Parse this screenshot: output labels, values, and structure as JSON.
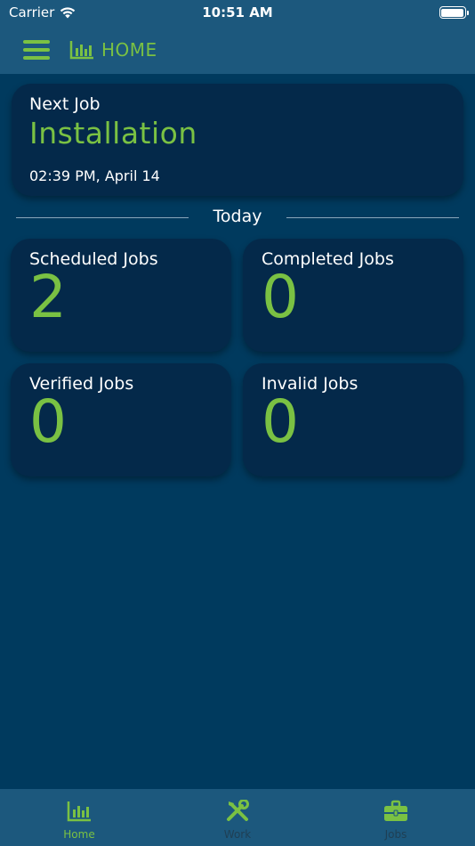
{
  "status_bar": {
    "carrier": "Carrier",
    "time": "10:51 AM"
  },
  "nav": {
    "title": "HOME"
  },
  "next_job": {
    "label": "Next Job",
    "type": "Installation",
    "datetime": "02:39 PM, April 14"
  },
  "section": {
    "today": "Today"
  },
  "stats": [
    {
      "label": "Scheduled Jobs",
      "value": "2"
    },
    {
      "label": "Completed Jobs",
      "value": "0"
    },
    {
      "label": "Verified Jobs",
      "value": "0"
    },
    {
      "label": "Invalid Jobs",
      "value": "0"
    }
  ],
  "tabs": [
    {
      "label": "Home",
      "icon": "bar-chart-icon",
      "active": true
    },
    {
      "label": "Work",
      "icon": "tools-icon",
      "active": false
    },
    {
      "label": "Jobs",
      "icon": "briefcase-icon",
      "active": false
    }
  ],
  "colors": {
    "accent": "#7ac143",
    "background": "#003a5e",
    "bars": "#1c587d",
    "card": "#04294a"
  }
}
